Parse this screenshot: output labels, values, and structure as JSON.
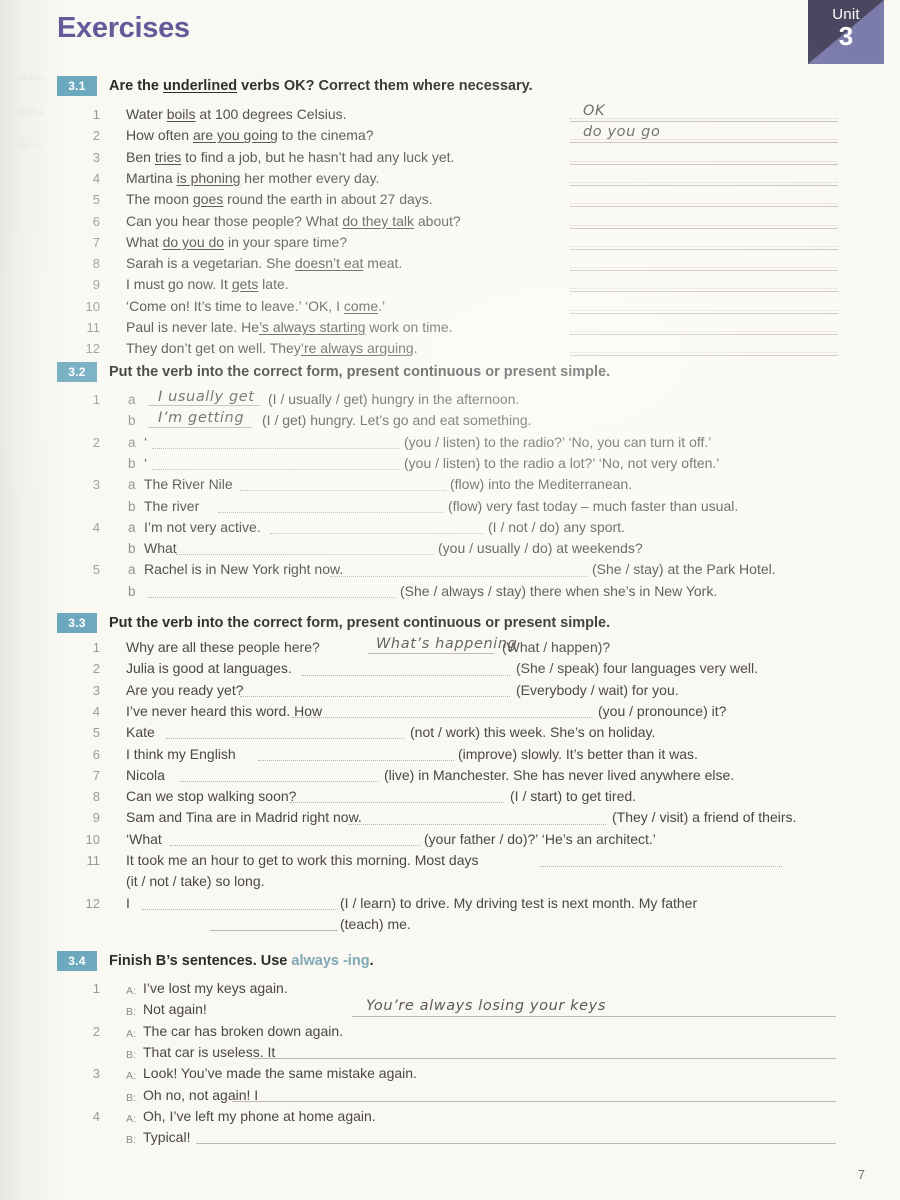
{
  "header": {
    "title": "Exercises",
    "unit_word": "Unit",
    "unit_number": "3"
  },
  "page_number": "7",
  "exercises": [
    {
      "number": "3.1",
      "instruction_parts": [
        "Are the ",
        "underlined",
        " verbs OK?  Correct them where necessary."
      ],
      "type": "correct-underlined",
      "items": [
        {
          "n": "1",
          "pre": "Water ",
          "verb": "boils",
          "post": " at 100 degrees Celsius.",
          "answer": "OK"
        },
        {
          "n": "2",
          "pre": "How often ",
          "verb": "are you going",
          "post": " to the cinema?",
          "answer": "do you go"
        },
        {
          "n": "3",
          "pre": "Ben ",
          "verb": "tries",
          "post": " to find a job, but he hasn’t had any luck yet.",
          "answer": ""
        },
        {
          "n": "4",
          "pre": "Martina ",
          "verb": "is phoning",
          "post": " her mother every day.",
          "answer": ""
        },
        {
          "n": "5",
          "pre": "The moon ",
          "verb": "goes",
          "post": " round the earth in about 27 days.",
          "answer": ""
        },
        {
          "n": "6",
          "pre": "Can you hear those people?  What ",
          "verb": "do they talk",
          "post": " about?",
          "answer": ""
        },
        {
          "n": "7",
          "pre": "What ",
          "verb": "do you do",
          "post": " in your spare time?",
          "answer": ""
        },
        {
          "n": "8",
          "pre": "Sarah is a vegetarian.  She ",
          "verb": "doesn’t eat",
          "post": " meat.",
          "answer": ""
        },
        {
          "n": "9",
          "pre": "I must go now.  It ",
          "verb": "gets",
          "post": " late.",
          "answer": ""
        },
        {
          "n": "10",
          "pre": "‘Come on!  It’s time to leave.’   ‘OK, I ",
          "verb": "come",
          "post": ".’",
          "answer": ""
        },
        {
          "n": "11",
          "pre": "Paul is never late.  He",
          "verb": "’s always starting",
          "post": " work on time.",
          "answer": ""
        },
        {
          "n": "12",
          "pre": "They don’t get on well.  They",
          "verb": "’re always arguing",
          "post": ".",
          "answer": ""
        }
      ]
    },
    {
      "number": "3.2",
      "instruction": "Put the verb into the correct form, present continuous or present simple.",
      "type": "fill-blank",
      "items": [
        {
          "n": "1",
          "sub": "a",
          "before": "",
          "answer": "I usually get",
          "after": "(I / usually / get) hungry in the afternoon."
        },
        {
          "n": "",
          "sub": "b",
          "before": "",
          "answer": "I’m getting",
          "after": "(I / get) hungry.  Let’s go and eat something."
        },
        {
          "n": "2",
          "sub": "a",
          "before": "‘",
          "answer": "",
          "after": "(you / listen) to the radio?’   ‘No, you can turn it off.’"
        },
        {
          "n": "",
          "sub": "b",
          "before": "‘",
          "answer": "",
          "after": "(you / listen) to the radio a lot?’   ‘No, not very often.’"
        },
        {
          "n": "3",
          "sub": "a",
          "before": "The River Nile",
          "answer": "",
          "after": "(flow) into the Mediterranean."
        },
        {
          "n": "",
          "sub": "b",
          "before": "The river",
          "answer": "",
          "after": "(flow) very fast today – much faster than usual."
        },
        {
          "n": "4",
          "sub": "a",
          "before": "I’m not very active.",
          "answer": "",
          "after": "(I / not / do) any sport."
        },
        {
          "n": "",
          "sub": "b",
          "before": "What",
          "answer": "",
          "after": "(you / usually / do) at weekends?"
        },
        {
          "n": "5",
          "sub": "a",
          "before": "Rachel is in New York right now.",
          "answer": "",
          "after": "(She / stay) at the Park Hotel."
        },
        {
          "n": "",
          "sub": "b",
          "before": "",
          "answer": "",
          "after": "(She / always / stay) there when she’s in New York."
        }
      ]
    },
    {
      "number": "3.3",
      "instruction": "Put the verb into the correct form, present continuous or present simple.",
      "type": "fill-blank",
      "items": [
        {
          "n": "1",
          "before": "Why are all these people here?",
          "answer": "What’s happening",
          "after": "(What / happen)?"
        },
        {
          "n": "2",
          "before": "Julia is good at languages.",
          "answer": "",
          "after": "(She / speak) four languages very well."
        },
        {
          "n": "3",
          "before": "Are you ready yet?",
          "answer": "",
          "after": "(Everybody / wait) for you."
        },
        {
          "n": "4",
          "before": "I’ve never heard this word.  How",
          "answer": "",
          "after": "(you / pronounce) it?"
        },
        {
          "n": "5",
          "before": "Kate",
          "answer": "",
          "after": "(not / work) this week.  She’s on holiday."
        },
        {
          "n": "6",
          "before": "I think my English",
          "answer": "",
          "after": "(improve) slowly.  It’s better than it was."
        },
        {
          "n": "7",
          "before": "Nicola",
          "answer": "",
          "after": "(live) in Manchester.  She has never lived anywhere else."
        },
        {
          "n": "8",
          "before": "Can we stop walking soon?",
          "answer": "",
          "after": "(I / start) to get tired."
        },
        {
          "n": "9",
          "before": "Sam and Tina are in Madrid right now.",
          "answer": "",
          "after": "(They / visit) a friend of theirs."
        },
        {
          "n": "10",
          "before": "‘What",
          "answer": "",
          "after": "(your father / do)?’   ‘He’s an architect.’"
        },
        {
          "n": "11",
          "before": "It took me an hour to get to work this morning.  Most days",
          "answer": "",
          "after": "(it / not / take) so long."
        },
        {
          "n": "12",
          "before": "I",
          "answer": "",
          "after": "(I / learn) to drive.  My driving test is next month.  My father",
          "after2": "(teach) me."
        }
      ]
    },
    {
      "number": "3.4",
      "instruction_parts": [
        "Finish B’s sentences.  Use ",
        "always -ing",
        "."
      ],
      "type": "dialogue",
      "items": [
        {
          "n": "1",
          "a_label": "A:",
          "a": "I’ve lost my keys again.",
          "b_label": "B:",
          "b": "Not again!",
          "answer": "You’re always losing your keys"
        },
        {
          "n": "2",
          "a_label": "A:",
          "a": "The car has broken down again.",
          "b_label": "B:",
          "b": "That car is useless.  It",
          "answer": ""
        },
        {
          "n": "3",
          "a_label": "A:",
          "a": "Look!  You’ve made the same mistake again.",
          "b_label": "B:",
          "b": "Oh no, not again!  I",
          "answer": ""
        },
        {
          "n": "4",
          "a_label": "A:",
          "a": "Oh, I’ve left my phone at home again.",
          "b_label": "B:",
          "b": "Typical!",
          "answer": ""
        }
      ]
    }
  ],
  "colors": {
    "title": "#66599a",
    "badge": "#6ca9bf",
    "unit_dark": "#4b4660",
    "unit_light": "#7b7caa",
    "highlight": "#7fa7b5"
  }
}
